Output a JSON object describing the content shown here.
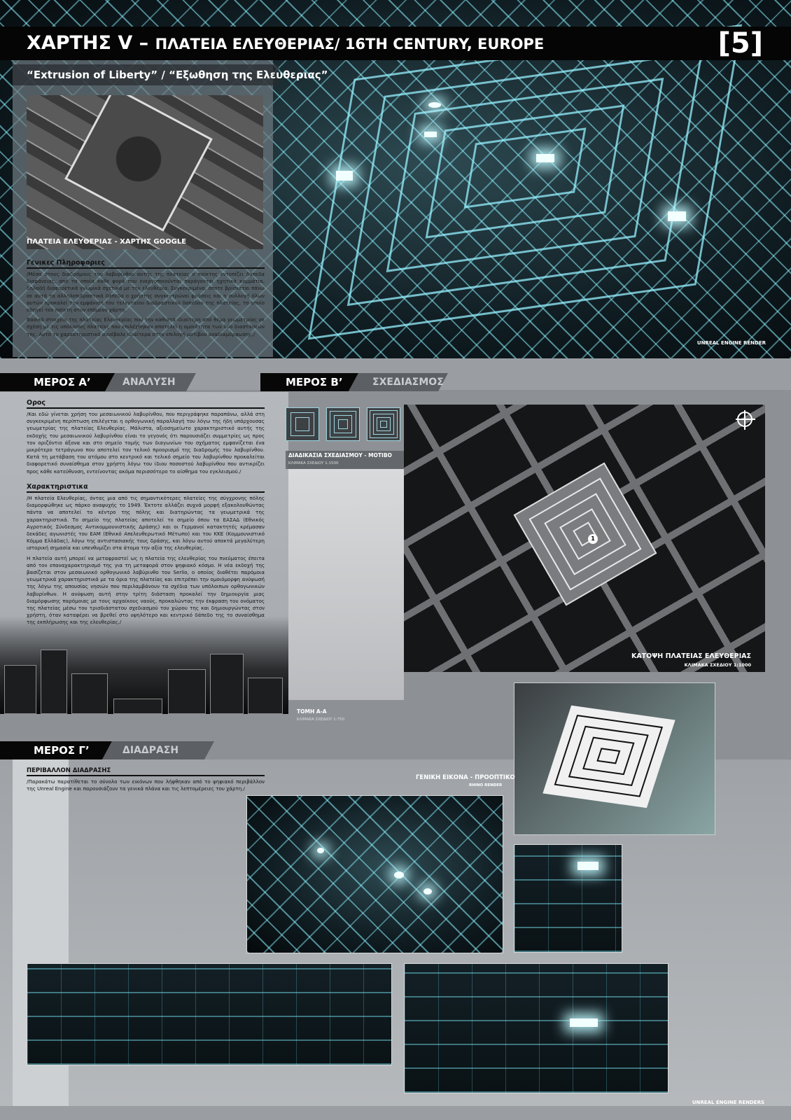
{
  "header": {
    "title_main": "ΧΑΡΤΗΣ V – ",
    "title_rest": "ΠΛΑΤΕΙΑ ΕΛΕΥΘΕΡΙΑΣ/ 16TH CENTURY, EUROPE",
    "page_number": "[5]",
    "subtitle": "“Extrusion of Liberty” / “Εξωθηση της Ελευθεριας”"
  },
  "hero": {
    "aerial_caption": "ΠΛΑΤΕΙΑ ΕΛΕΥΘΕΡΙΑΣ - ΧΑΡΤΗΣ GOOGLE",
    "general_info_heading": "Γενικες Πληροφοριες",
    "general_info_p1": "/Μέσα στους διαδρόμους του λαβυρίνθου αυτής της πλατείας ο παίκτης εντοπίζει δάπεδα διαφάνειας, από τα οποία κάθε φορά που ενεργοποιούνται παράγονται ηχητικά κομμάτια, δηλαδή διαφορετικά γνωμικά σχετικά με την ελευθερία. Συγκεκριμένα, όποτε βρίσκεται πάνω σε αυτά τα αλληλεπιδραστικά δάπεδα ο χρήστης συγκεντρώνει φράσεις και η συλλογή όλων αυτών προκαλεί την εμφάνιση του τελευταίου διαδραστικού δαπέδου της πλατείας, το οποίο οδηγεί τον παίκτη στον επόμενο χάρτη.",
    "general_info_p2": "Βασικό στοιχείο της πλατείας Ελευθερίας που την καθιστά ιδιαίτερη από θέμα γεωμετρίας σε σχέση με τις υπόλοιπες πλατείες που επιλέχθηκαν αποτελεί η ομοιότητα των δύο διαστάσεών της. Αυτό το χαρακτηριστικό συνέβαλε ιδιαίτερα στην επιλογή μοτίβου αναδιαμόρφωσης./",
    "render_label": "UNREAL ENGINE RENDER"
  },
  "part_a": {
    "tab": "ΜΕΡΟΣ Α’",
    "tab_sub": "ΑΝΑΛΥΣΗ",
    "oros_heading": "Ορος",
    "oros_text": "/Και εδώ γίνεται χρήση του μεσαιωνικού λαβυρίνθου, που περιγράφηκε παραπάνω, αλλά στη συγκεκριμένη περίπτωση επιλέγεται η ορθογωνική παραλλαγή του λόγω της ήδη υπάρχουσας γεωμετρίας της πλατείας Ελευθερίας. Μάλιστα, αξιοσημείωτο χαρακτηριστικό αυτής της εκδοχής του μεσαιωνικού λαβυρίνθου είναι το γεγονός ότι παρουσιάζει συμμετρίες ως προς τον οριζόντιο άξονα και στο σημείο τομής των διαγωνίων του σχήματος εμφανίζεται ένα μικρότερο τετράγωνο που αποτελεί τον τελικό προορισμό της διαδρομής του λαβυρίνθου. Κατά τη μετάβαση του ατόμου στο κεντρικό και τελικό σημείο του λαβυρίνθου προκαλείται διαφορετικό συναίσθημα στον χρήστη λόγω του ίδιου ποσοστού λαβυρίνθου που αντικρίζει προς κάθε κατεύθυνση, εντείνοντας ακόμα περισσότερο το αίσθημα του εγκλεισμού./",
    "char_heading": "Χαρακτηριστικα",
    "char_p1": "/Η πλατεία Ελευθερίας, όντας μια από τις σημαντικότερες πλατείες της σύγχρονης πόλης διαμορφώθηκε ως πάρκο αναψυχής το 1949. Έκτοτε αλλάζει συχνά μορφή εξακολουθώντας πάντα να αποτελεί το κέντρο της πόλης και διατηρώντας τα γεωμετρικά της χαρακτηριστικά. Το σημείο της πλατείας αποτελεί το σημείο όπου τα ΕΑΣΑΔ (Εθνικός Αγροτικός Σύνδεσμος Αντικομμουνιστικής Δράσης) και οι Γερμανοί κατακτητές κρέμασαν δεκάδες αγωνιστές του ΕΑΜ (Εθνικό Απελευθερωτικό Μέτωπο) και του ΚΚΕ (Κομμουνιστικό Κόμμα Ελλάδας), λόγω της αντιστασιακής τους δράσης, και λόγω αυτού αποκτά μεγαλύτερη ιστορική σημασία και υπενθυμίζει στα άτομα την αξία της ελευθερίας.",
    "char_p2": "Η πλατεία αυτή μπορεί να μεταφραστεί ως η πλατεία της ελευθερίας του πνεύματος έπειτα από τον επαναχαρακτηρισμό της για τη μεταφορά στον ψηφιακό κόσμο. Η νέα εκδοχή της βασίζεται στον μεσαιωνικό ορθογωνικό λαβύρινθο του Serlio, ο οποίος διαθέτει παρόμοια γεωμετρικά χαρακτηριστικά με τα όρια της πλατείας και επιτρέπει την ομοιόμορφη ανύψωσή της λόγω της απουσίας νησιών που περιλαμβάνουν τα σχέδια των υπόλοιπων ορθογωνικών λαβυρίνθων. Η ανύψωση αυτή στην τρίτη διάσταση προκαλεί την δημιουργία μιας διαμόρφωσης παρόμοιας με τους αρχαίκους ναούς, προκαλώντας την έκφραση του ονόματος της πλατείας μέσω του τρισδιάστατου σχεδιασμού του χώρου της και δημιουργώντας στον χρήστη, όταν καταφέρει να βρεθεί στο υψηλότερο και κεντρικό δάπεδο της το συναίσθημα της εκπλήρωσης και της ελευθερίας./"
  },
  "part_b": {
    "tab": "ΜΕΡΟΣ Β’",
    "tab_sub": "ΣΧΕΔΙΑΣΜΟΣ",
    "motif_title": "ΔΙΑΔΙΚΑΣΙΑ ΣΧΕΔΙΑΣΜΟΥ - ΜΟΤΙΒΟ",
    "motif_scale": "ΚΛΙΜΑΚΑ ΣΧΕΔΙΟΥ 1:1500",
    "plan_title": "ΚΑΤΟΨΗ ΠΛΑΤΕΙΑΣ ΕΛΕΥΘΕΡΙΑΣ",
    "plan_scale": "ΚΛΙΜΑΚΑ ΣΧΕΔΙΟΥ 1:1000",
    "plan_marker": "1",
    "section_title": "ΤΟΜΗ Α-Α",
    "section_scale": "ΚΛΙΜΑΚΑ ΣΧΕΔΙΟΥ 1:750"
  },
  "part_g": {
    "tab": "ΜΕΡΟΣ Γ’",
    "tab_sub": "ΔΙΑΔΡΑΣΗ",
    "env_heading": "ΠΕΡΙΒΑΛΛΟΝ ΔΙΑΔΡΑΣΗΣ",
    "env_text": "/Παρακάτω παρατίθεται το σύνολο των εικόνων που λήφθηκαν από το ψηφιακό περιβάλλον της Unreal Engine και παρουσιάζουν τα γενικά πλάνα και τις λεπτομέρειες του χάρτη./",
    "general_title": "ΓΕΝΙΚΗ ΕΙΚΟΝΑ - ΠΡΟΟΠΤΙΚΟ",
    "rhino_label": "RHINO RENDER",
    "renders_label": "UNREAL ENGINE RENDERS"
  }
}
